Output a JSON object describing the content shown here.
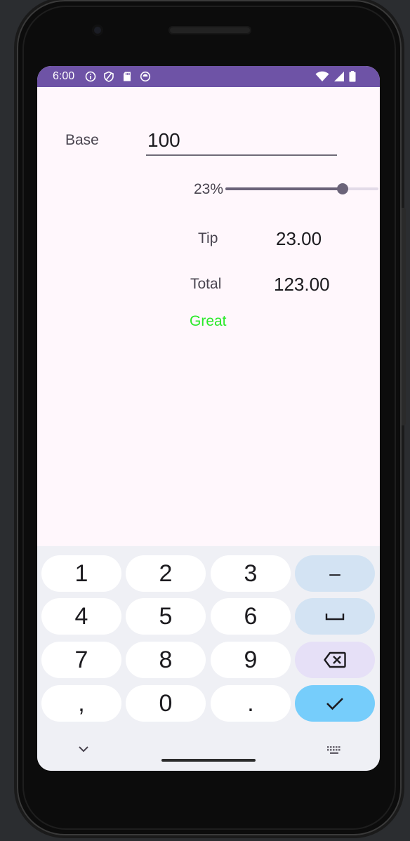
{
  "status_bar": {
    "time": "6:00",
    "left_icons": [
      "info-icon",
      "shield-icon",
      "sd-card-icon",
      "sync-icon"
    ],
    "right_icons": [
      "wifi-icon",
      "cell-signal-icon",
      "battery-icon"
    ],
    "color": "#6e53a6"
  },
  "app": {
    "base_label": "Base",
    "base_value": "100",
    "tip_percent_label": "23%",
    "tip_percent_value": 23,
    "tip_percent_max": 30,
    "tip_label": "Tip",
    "tip_value": "23.00",
    "total_label": "Total",
    "total_value": "123.00",
    "rating_text": "Great",
    "rating_color": "#2aea2a"
  },
  "keyboard": {
    "rows": [
      [
        {
          "label": "1",
          "kind": "digit"
        },
        {
          "label": "2",
          "kind": "digit"
        },
        {
          "label": "3",
          "kind": "digit"
        },
        {
          "label": "–",
          "kind": "fn",
          "icon": "minus-icon"
        }
      ],
      [
        {
          "label": "4",
          "kind": "digit"
        },
        {
          "label": "5",
          "kind": "digit"
        },
        {
          "label": "6",
          "kind": "digit"
        },
        {
          "label": "",
          "kind": "fn",
          "icon": "space-icon"
        }
      ],
      [
        {
          "label": "7",
          "kind": "digit"
        },
        {
          "label": "8",
          "kind": "digit"
        },
        {
          "label": "9",
          "kind": "digit"
        },
        {
          "label": "",
          "kind": "del",
          "icon": "backspace-icon"
        }
      ],
      [
        {
          "label": ",",
          "kind": "digit"
        },
        {
          "label": "0",
          "kind": "digit"
        },
        {
          "label": ".",
          "kind": "digit"
        },
        {
          "label": "",
          "kind": "done",
          "icon": "check-icon"
        }
      ]
    ],
    "nav_left_icon": "chevron-down-icon",
    "nav_right_icon": "keyboard-icon"
  }
}
